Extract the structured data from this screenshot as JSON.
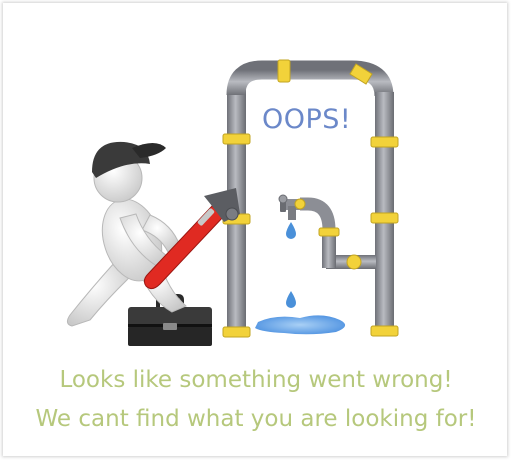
{
  "illustration": {
    "speech": "OOPS!",
    "icons": [
      "plumber-figure-icon",
      "pipe-wrench-icon",
      "toolbox-icon",
      "leaking-pipe-icon",
      "water-drop-icon",
      "water-puddle-icon"
    ]
  },
  "message": {
    "line1": "Looks like something went wrong!",
    "line2": "We cant find what you are looking for!"
  },
  "colors": {
    "message_text": "#b6c87c",
    "oops_text": "#6b88c9",
    "pipe": "#8a8c93",
    "pipe_fitting": "#f2d23a",
    "wrench": "#e02a22",
    "water": "#4a90d9"
  }
}
